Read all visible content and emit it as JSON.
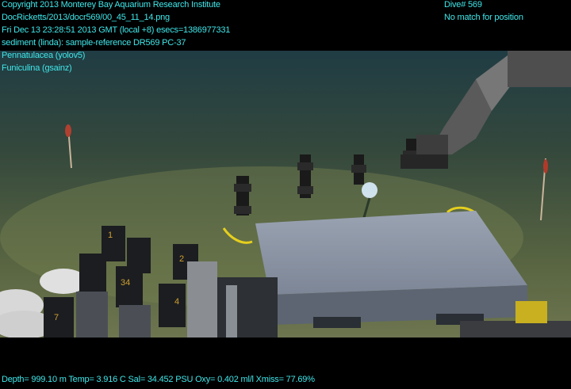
{
  "overlay": {
    "top_left": [
      "Copyright 2013 Monterey Bay Aquarium Research Institute",
      "DocRicketts/2013/docr569/00_45_11_14.png",
      "Fri Dec 13 23:28:51 2013 GMT (local +8)  esecs=1386977331",
      "sediment (linda): sample-reference DR569 PC-37",
      "Pennatulacea (yolov5)",
      "Funiculina (gsainz)"
    ],
    "top_right": [
      "Dive# 569",
      "No match for position"
    ],
    "bottom": "Depth= 999.10 m  Temp= 3.916 C  Sal= 34.452 PSU  Oxy= 0.402 ml/l  Xmiss= 77.69%"
  },
  "scene": {
    "core_labels": [
      "1",
      "2",
      "34",
      "4",
      "7"
    ],
    "colors": {
      "sediment_dark": "#2c3a2c",
      "sediment_mid": "#4a5a3c",
      "sediment_light": "#6f7a52",
      "water": "#1d3a44",
      "tray": "#8e98a8",
      "yellow_rope": "#e8d020",
      "overlay_text": "#3fe7ea"
    }
  }
}
